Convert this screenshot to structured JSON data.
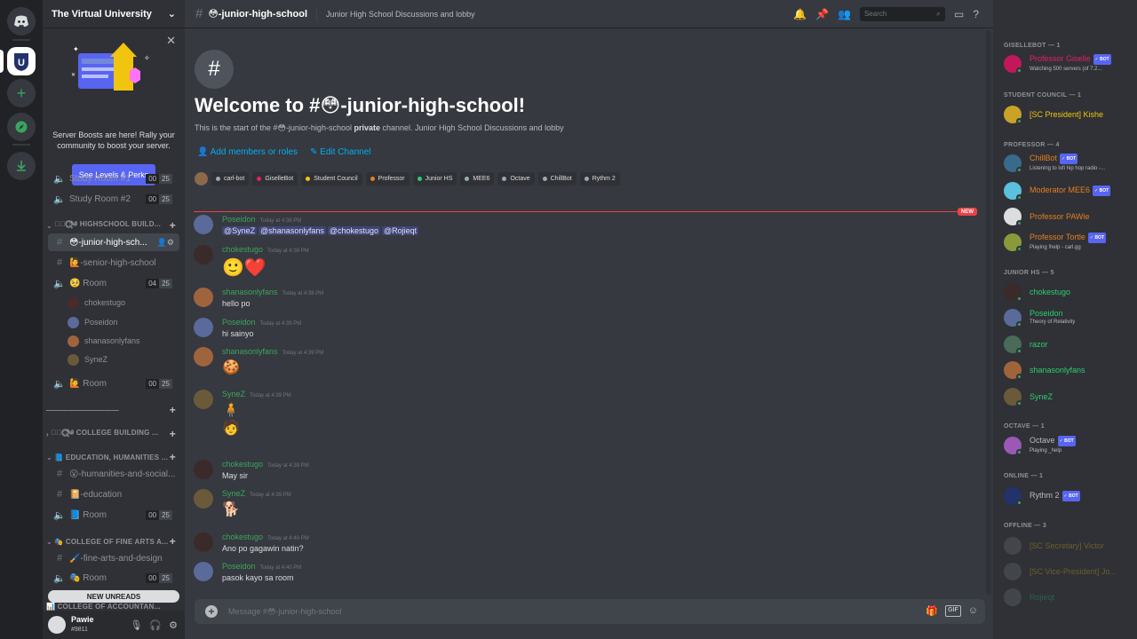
{
  "server": {
    "name": "The Virtual University",
    "icon_letter": "U"
  },
  "boost_banner": {
    "text": "Server Boosts are here! Rally your community to boost your server.",
    "button": "See Levels & Perks"
  },
  "channels": [
    {
      "type": "voice",
      "name": "Study Room #1",
      "count_a": "00",
      "count_b": "25"
    },
    {
      "type": "voice",
      "name": "Study Room #2",
      "count_a": "00",
      "count_b": "25"
    }
  ],
  "categories": {
    "highschool": "✧ཻུ۪⃝⃟༄ HIGHSCHOOL BUILD...",
    "divider": "——————————",
    "college_building": "✧ཻུ۪⃝⃟༄ COLLEGE BUILDING ...",
    "education": "📘 EDUCATION, HUMANITIES ...",
    "fine_arts": "🎭 COLLEGE OF FINE ARTS A...",
    "accountancy": "📊 COLLEGE OF ACCOUNTAN..."
  },
  "hs_channels": [
    {
      "icon": "#",
      "name": "😳-junior-high-sch..."
    },
    {
      "icon": "#",
      "name": "🙋-senior-high-school"
    },
    {
      "icon": "🔈",
      "name": "🥺 Room",
      "count_a": "04",
      "count_b": "25"
    },
    {
      "icon": "🔈",
      "name": "🙋 Room",
      "count_a": "00",
      "count_b": "25"
    }
  ],
  "voice_users": [
    "chokestugo",
    "Poseidon",
    "shanasonlyfans",
    "SyneZ"
  ],
  "edu_channels": [
    {
      "icon": "#",
      "name": "😮-humanities-and-social..."
    },
    {
      "icon": "#",
      "name": "📔-education"
    },
    {
      "icon": "🔈",
      "name": "📘 Room",
      "count_a": "00",
      "count_b": "25"
    }
  ],
  "arts_channels": [
    {
      "icon": "#",
      "name": "🖌️-fine-arts-and-design"
    },
    {
      "icon": "🔈",
      "name": "🎭 Room",
      "count_a": "00",
      "count_b": "25"
    }
  ],
  "new_unreads": "NEW UNREADS",
  "user": {
    "name": "Pawie",
    "tag": "#9811"
  },
  "header": {
    "channel": "😳-junior-high-school",
    "topic": "Junior High School Discussions and lobby",
    "search_placeholder": "Search"
  },
  "welcome": {
    "title": "Welcome to #😳-junior-high-school!",
    "start": "This is the start of the #😳-junior-high-school",
    "private": "private",
    "rest": "channel. Junior High School Discussions and lobby",
    "add_members": "Add members or roles",
    "edit_channel": "Edit Channel"
  },
  "roles": [
    {
      "name": "carl-bot",
      "color": "#99aab5"
    },
    {
      "name": "GiselleBot",
      "color": "#e91e63"
    },
    {
      "name": "Student Council",
      "color": "#f1c40f"
    },
    {
      "name": "Professor",
      "color": "#e67e22"
    },
    {
      "name": "Junior HS",
      "color": "#2ecc71"
    },
    {
      "name": "MEE6",
      "color": "#99aab5"
    },
    {
      "name": "Octave",
      "color": "#99aab5"
    },
    {
      "name": "ChillBot",
      "color": "#99aab5"
    },
    {
      "name": "Rythm 2",
      "color": "#99aab5"
    }
  ],
  "new_tag": "NEW",
  "messages": [
    {
      "author": "Poseidon",
      "time": "Today at 4:38 PM",
      "mentions": [
        "@SyneZ",
        "@shanasonlyfans",
        "@chokestugo",
        "@Rojieqt"
      ]
    },
    {
      "author": "chokestugo",
      "time": "Today at 4:38 PM",
      "text": "🙂❤️"
    },
    {
      "author": "shanasonlyfans",
      "time": "Today at 4:38 PM",
      "text": "hello po"
    },
    {
      "author": "Poseidon",
      "time": "Today at 4:39 PM",
      "text": "hi sainyo"
    },
    {
      "author": "shanasonlyfans",
      "time": "Today at 4:39 PM",
      "text": "🍪"
    },
    {
      "author": "SyneZ",
      "time": "Today at 4:39 PM",
      "text": "🧍",
      "text2": "🧑"
    },
    {
      "author": "chokestugo",
      "time": "Today at 4:39 PM",
      "text": "May sir"
    },
    {
      "author": "SyneZ",
      "time": "Today at 4:39 PM",
      "text": "🐕"
    },
    {
      "author": "chokestugo",
      "time": "Today at 4:40 PM",
      "text": "Ano po gagawin natin?"
    },
    {
      "author": "Poseidon",
      "time": "Today at 4:40 PM",
      "text": "pasok kayo sa room"
    }
  ],
  "composer_placeholder": "Message #😳-junior-high-school",
  "member_groups": {
    "gisellebot": "GISELLEBOT — 1",
    "student_council": "STUDENT COUNCIL — 1",
    "professor": "PROFESSOR — 4",
    "junior_hs": "JUNIOR HS — 5",
    "octave": "OCTAVE — 1",
    "online": "ONLINE — 1",
    "offline": "OFFLINE — 3"
  },
  "members": [
    {
      "name": "Professor Giselle",
      "activity": "Watching 500 servers (of 7.2...",
      "color": "#e91e63",
      "bot": true
    },
    {
      "name": "[SC President] Kishe",
      "activity": "",
      "color": "#f1c40f"
    },
    {
      "name": "ChillBot",
      "activity": "Listening to lofi hip hop radio -...",
      "color": "#e67e22",
      "bot": true
    },
    {
      "name": "Moderator MEE6",
      "activity": "",
      "color": "#e67e22",
      "bot": true
    },
    {
      "name": "Professor PAWie",
      "activity": "",
      "color": "#e67e22"
    },
    {
      "name": "Professor Tortle",
      "activity": "Playing !help - carl.gg",
      "color": "#e67e22",
      "bot": true
    },
    {
      "name": "chokestugo",
      "activity": "",
      "color": "#2ecc71"
    },
    {
      "name": "Poseidon",
      "activity": "Theory of Relativity",
      "color": "#2ecc71"
    },
    {
      "name": "razor",
      "activity": "",
      "color": "#2ecc71"
    },
    {
      "name": "shanasonlyfans",
      "activity": "",
      "color": "#2ecc71"
    },
    {
      "name": "SyneZ",
      "activity": "",
      "color": "#2ecc71"
    },
    {
      "name": "Octave",
      "activity": "Playing _help",
      "color": "#b9bbbe",
      "bot": true
    },
    {
      "name": "Rythm 2",
      "activity": "",
      "color": "#b9bbbe",
      "bot": true
    },
    {
      "name": "[SC Secretary] Victor",
      "activity": "",
      "color": "#f1c40f"
    },
    {
      "name": "[SC Vice-President] Jo...",
      "activity": "",
      "color": "#f1c40f"
    },
    {
      "name": "Rojieqt",
      "activity": "",
      "color": "#2ecc71"
    }
  ],
  "bot_label": "✓ BOT",
  "colors": {
    "accent": "#5865f2",
    "junior": "#3ba55d",
    "new_line": "#ed4245"
  },
  "icons": [
    "discord-home-icon",
    "add-server-icon",
    "explore-icon",
    "download-icon",
    "bell-icon",
    "pin-icon",
    "members-icon",
    "inbox-icon",
    "help-icon",
    "gift-icon",
    "gif-icon",
    "emoji-icon"
  ]
}
